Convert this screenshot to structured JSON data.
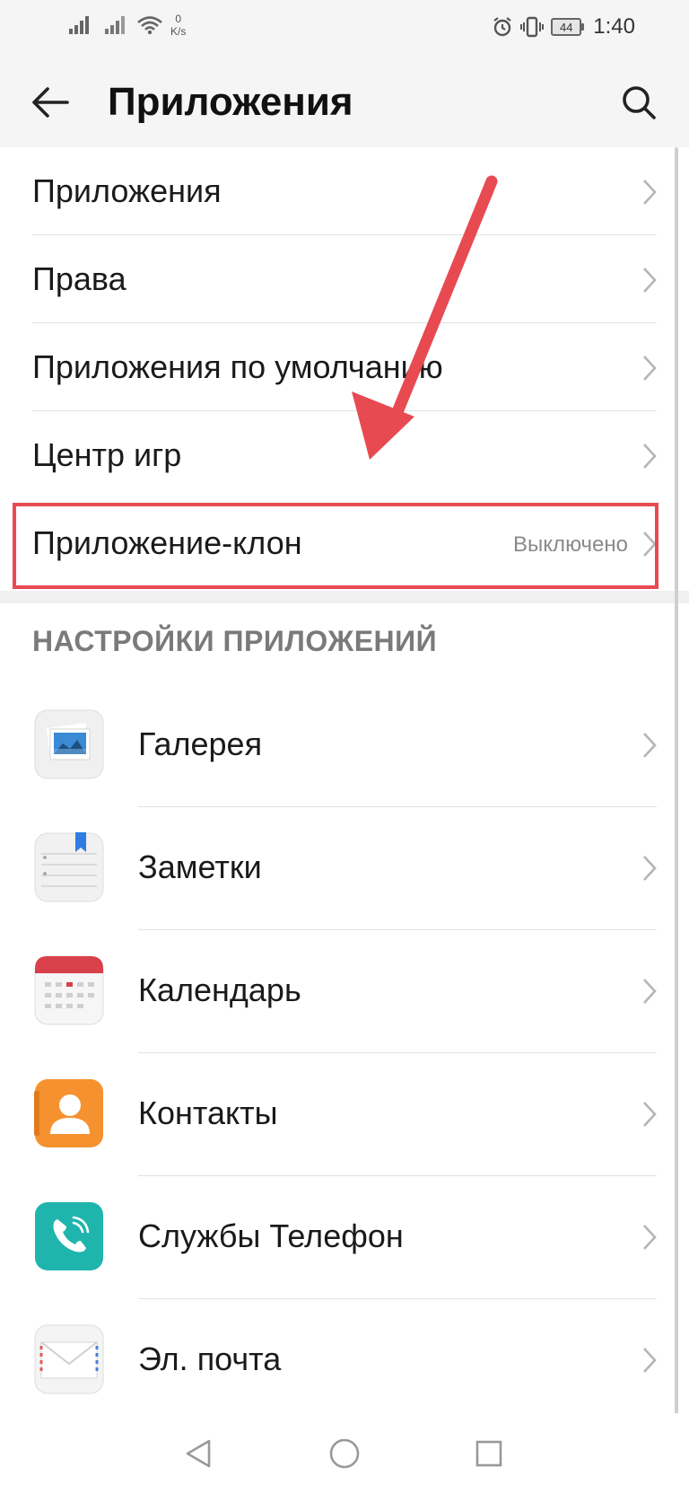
{
  "status_bar": {
    "net_speed_value": "0",
    "net_speed_unit": "K/s",
    "battery_level": "44",
    "time": "1:40"
  },
  "app_bar": {
    "title": "Приложения"
  },
  "menu": {
    "items": [
      {
        "label": "Приложения",
        "status": ""
      },
      {
        "label": "Права",
        "status": ""
      },
      {
        "label": "Приложения по умолчанию",
        "status": ""
      },
      {
        "label": "Центр игр",
        "status": ""
      },
      {
        "label": "Приложение-клон",
        "status": "Выключено"
      }
    ]
  },
  "section": {
    "header": "НАСТРОЙКИ ПРИЛОЖЕНИЙ"
  },
  "apps": [
    {
      "label": "Галерея",
      "icon": "gallery-icon"
    },
    {
      "label": "Заметки",
      "icon": "notes-icon"
    },
    {
      "label": "Календарь",
      "icon": "calendar-icon"
    },
    {
      "label": "Контакты",
      "icon": "contacts-icon"
    },
    {
      "label": "Службы Телефон",
      "icon": "phone-icon"
    },
    {
      "label": "Эл. почта",
      "icon": "email-icon"
    }
  ],
  "colors": {
    "annotation_red": "#e84a52",
    "contacts_orange": "#f5922f",
    "phone_teal": "#1fb5ad",
    "calendar_red": "#d8404a",
    "notes_blue": "#2f7de1"
  }
}
